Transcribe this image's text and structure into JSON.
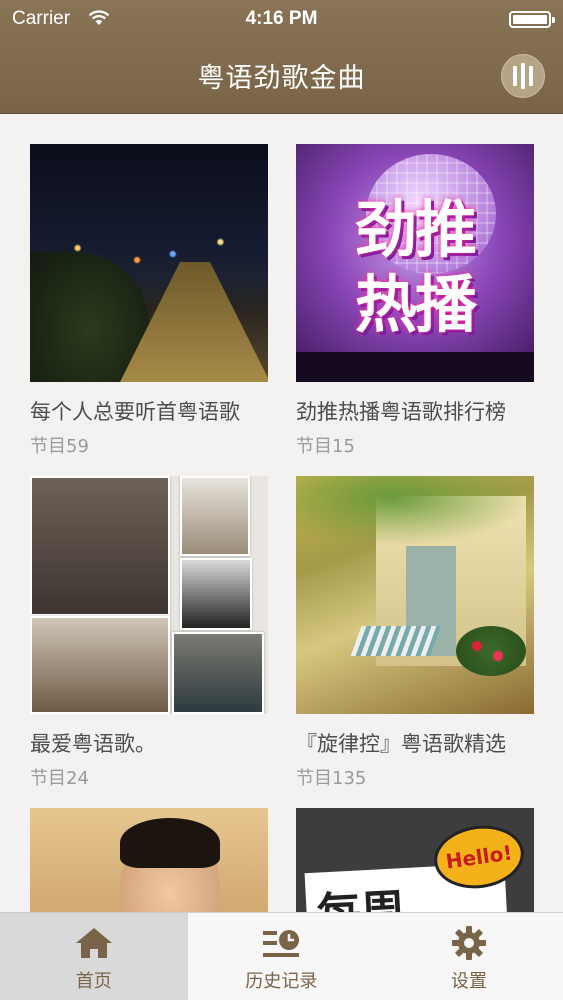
{
  "status_bar": {
    "carrier": "Carrier",
    "time": "4:16 PM",
    "battery_level": 1.0
  },
  "nav": {
    "title": "粤语劲歌金曲",
    "right_icon": "equalizer-icon"
  },
  "playlists": [
    {
      "title": "每个人总要听首粤语歌",
      "count": "节目59",
      "thumb": "city-night-road"
    },
    {
      "title": "劲推热播粤语歌排行榜",
      "count": "节目15",
      "thumb": "purple-disco-poster",
      "thumb_text": [
        "劲推",
        "热播"
      ]
    },
    {
      "title": "最爱粤语歌。",
      "count": "节目24",
      "thumb": "portrait-collage"
    },
    {
      "title": "『旋律控』粤语歌精选",
      "count": "节目135",
      "thumb": "garden-courtyard"
    },
    {
      "title": "",
      "count": "",
      "thumb": "portrait-man"
    },
    {
      "title": "",
      "count": "",
      "thumb": "hello-poster",
      "thumb_text": [
        "Hello!",
        "每周"
      ]
    }
  ],
  "tabbar": {
    "tabs": [
      {
        "label": "首页",
        "icon": "home-icon",
        "active": true
      },
      {
        "label": "历史记录",
        "icon": "history-icon",
        "active": false
      },
      {
        "label": "设置",
        "icon": "gear-icon",
        "active": false
      }
    ]
  },
  "colors": {
    "nav_bg": "#7a6448",
    "accent_text": "#7a6448",
    "active_tab_bg": "#d9d9d9"
  }
}
